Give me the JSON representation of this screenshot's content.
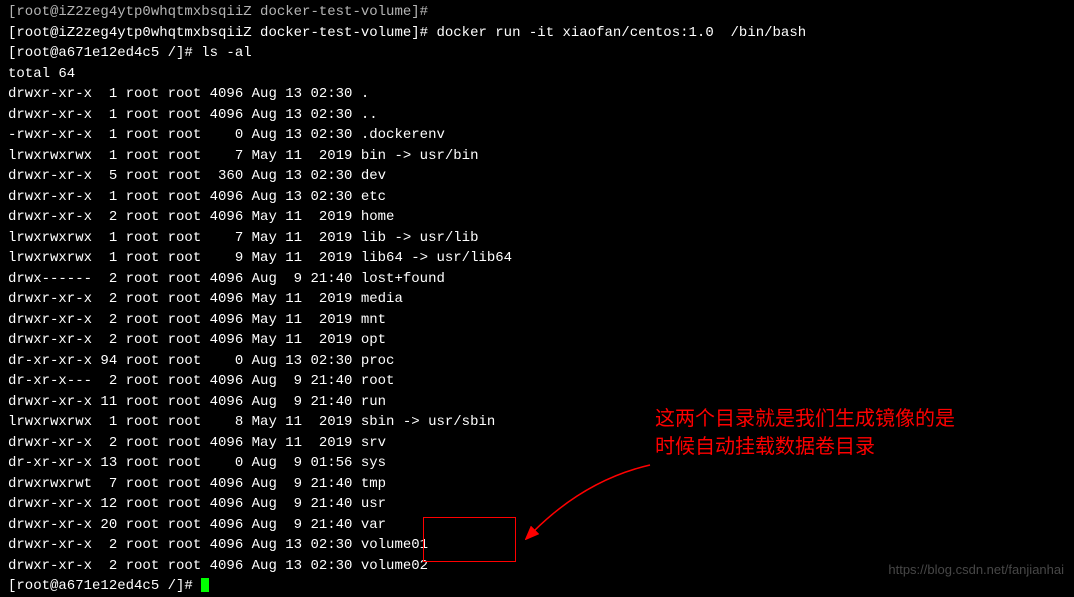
{
  "lines": {
    "l0": "[root@iZ2zeg4ytp0whqtmxbsqiiZ docker-test-volume]#",
    "l1": "[root@iZ2zeg4ytp0whqtmxbsqiiZ docker-test-volume]# docker run -it xiaofan/centos:1.0  /bin/bash",
    "l2": "[root@a671e12ed4c5 /]# ls -al",
    "l3": "total 64",
    "l4": "drwxr-xr-x  1 root root 4096 Aug 13 02:30 .",
    "l5": "drwxr-xr-x  1 root root 4096 Aug 13 02:30 ..",
    "l6": "-rwxr-xr-x  1 root root    0 Aug 13 02:30 .dockerenv",
    "l7": "lrwxrwxrwx  1 root root    7 May 11  2019 bin -> usr/bin",
    "l8": "drwxr-xr-x  5 root root  360 Aug 13 02:30 dev",
    "l9": "drwxr-xr-x  1 root root 4096 Aug 13 02:30 etc",
    "l10": "drwxr-xr-x  2 root root 4096 May 11  2019 home",
    "l11": "lrwxrwxrwx  1 root root    7 May 11  2019 lib -> usr/lib",
    "l12": "lrwxrwxrwx  1 root root    9 May 11  2019 lib64 -> usr/lib64",
    "l13": "drwx------  2 root root 4096 Aug  9 21:40 lost+found",
    "l14": "drwxr-xr-x  2 root root 4096 May 11  2019 media",
    "l15": "drwxr-xr-x  2 root root 4096 May 11  2019 mnt",
    "l16": "drwxr-xr-x  2 root root 4096 May 11  2019 opt",
    "l17": "dr-xr-xr-x 94 root root    0 Aug 13 02:30 proc",
    "l18": "dr-xr-x---  2 root root 4096 Aug  9 21:40 root",
    "l19": "drwxr-xr-x 11 root root 4096 Aug  9 21:40 run",
    "l20": "lrwxrwxrwx  1 root root    8 May 11  2019 sbin -> usr/sbin",
    "l21": "drwxr-xr-x  2 root root 4096 May 11  2019 srv",
    "l22": "dr-xr-xr-x 13 root root    0 Aug  9 01:56 sys",
    "l23": "drwxrwxrwt  7 root root 4096 Aug  9 21:40 tmp",
    "l24": "drwxr-xr-x 12 root root 4096 Aug  9 21:40 usr",
    "l25": "drwxr-xr-x 20 root root 4096 Aug  9 21:40 var",
    "l26": "drwxr-xr-x  2 root root 4096 Aug 13 02:30 volume01",
    "l27": "drwxr-xr-x  2 root root 4096 Aug 13 02:30 volume02",
    "l28": "[root@a671e12ed4c5 /]# "
  },
  "annotation": {
    "line1": "这两个目录就是我们生成镜像的是",
    "line2": "时候自动挂载数据卷目录"
  },
  "watermark": "https://blog.csdn.net/fanjianhai"
}
